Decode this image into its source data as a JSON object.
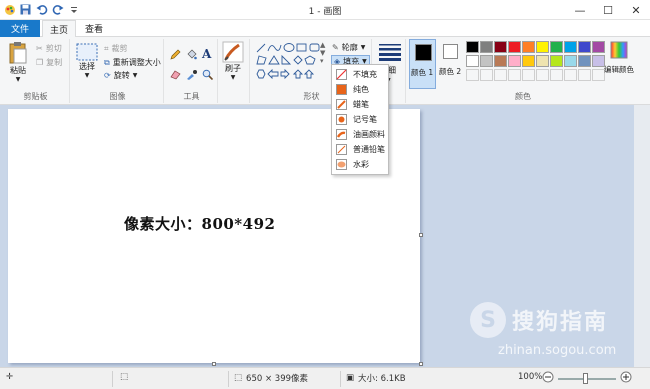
{
  "window": {
    "title": "1 - 画图",
    "controls": [
      "—",
      "☐",
      "✕"
    ]
  },
  "tabs": {
    "file": "文件",
    "home": "主页",
    "view": "查看"
  },
  "ribbon": {
    "clipboard": {
      "group": "剪贴板",
      "paste": "粘贴",
      "cut": "剪切",
      "copy": "复制"
    },
    "image": {
      "group": "图像",
      "select": "选择",
      "crop": "裁剪",
      "resize": "重新调整大小",
      "rotate": "旋转"
    },
    "tools": {
      "group": "工具"
    },
    "brushes": {
      "label": "刷子"
    },
    "shapes": {
      "group": "形状",
      "outline": "轮廓",
      "fill": "填充"
    },
    "size": {
      "label": "粗细"
    },
    "colors": {
      "group": "颜色",
      "color1": "颜色 1",
      "color2": "颜色 2",
      "edit": "编辑颜色",
      "palette_row1": [
        "#000000",
        "#7f7f7f",
        "#880015",
        "#ed1c24",
        "#ff7f27",
        "#fff200",
        "#22b14c",
        "#00a2e8",
        "#3f48cc",
        "#a349a4"
      ],
      "palette_row2": [
        "#ffffff",
        "#c3c3c3",
        "#b97a57",
        "#ffaec9",
        "#ffc90e",
        "#efe4b0",
        "#b5e61d",
        "#99d9ea",
        "#7092be",
        "#c8bfe7"
      ]
    }
  },
  "fill_menu": [
    "不填充",
    "纯色",
    "蜡笔",
    "记号笔",
    "油画颜料",
    "普通铅笔",
    "水彩"
  ],
  "canvas": {
    "text": "像素大小：800*492"
  },
  "status": {
    "dimensions": "650 × 399像素",
    "size": "大小: 6.1KB",
    "zoom": "100%"
  },
  "watermark": {
    "brand": "搜狗指南",
    "url": "zhinan.sogou.com"
  }
}
